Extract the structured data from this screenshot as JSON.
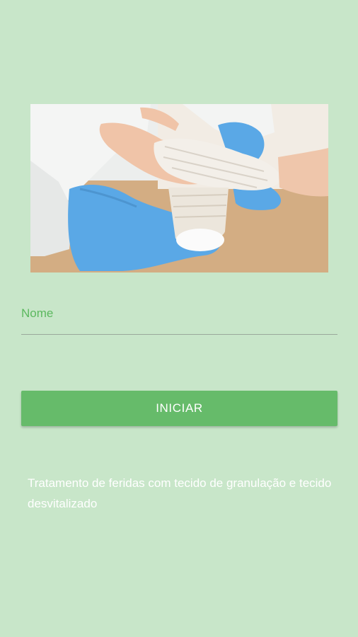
{
  "hero": {
    "image_subject": "hands-bandage-photo"
  },
  "form": {
    "name_label": "Nome",
    "name_value": ""
  },
  "actions": {
    "start_label": "INICIAR"
  },
  "description": "Tratamento de feridas com tecido de granulação e tecido desvitalizado",
  "colors": {
    "background": "#c8e6c9",
    "accent": "#66bb6a",
    "label": "#5cb85f",
    "text_light": "#ffffff"
  }
}
